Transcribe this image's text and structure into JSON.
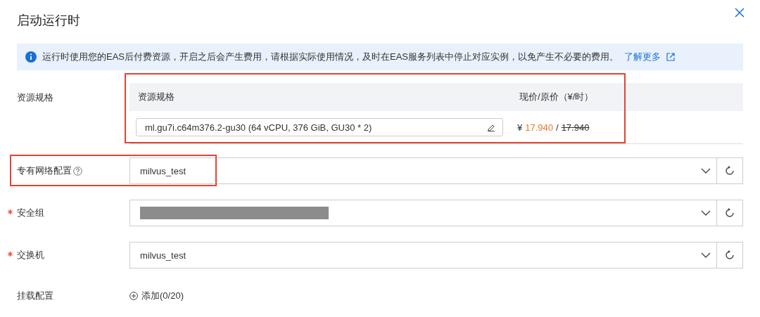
{
  "dialog": {
    "title": "启动运行时"
  },
  "notice": {
    "text": "运行时使用您的EAS后付费资源，开启之后会产生费用，请根据实际使用情况，及时在EAS服务列表中停止对应实例，以免产生不必要的费用。",
    "link": "了解更多"
  },
  "resource_spec": {
    "label": "资源规格",
    "columns": [
      "资源规格",
      "现价/原价（¥/时）"
    ],
    "value": "ml.gu7i.c64m376.2-gu30  (64 vCPU, 376 GiB, GU30 * 2)",
    "currency": "¥",
    "price": "17.940",
    "separator": "/",
    "original_price": "17.940",
    "highlighted": true
  },
  "fields": [
    {
      "kind": "select",
      "label": "专有网络配置",
      "help": true,
      "required": false,
      "value": "milvus_test",
      "highlighted": true
    },
    {
      "kind": "redacted",
      "label": "安全组",
      "help": false,
      "required": true,
      "highlighted": false
    },
    {
      "kind": "select",
      "label": "交换机",
      "help": false,
      "required": true,
      "value": "milvus_test",
      "highlighted": false
    }
  ],
  "mount": {
    "label": "挂载配置",
    "action": "添加(0/20)"
  }
}
